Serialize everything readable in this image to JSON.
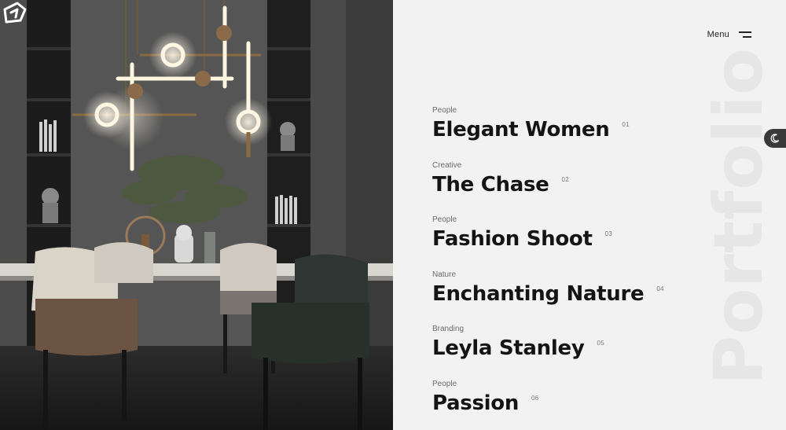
{
  "brand": {
    "logo": "logo-icon"
  },
  "header": {
    "menu_label": "Menu",
    "menu_icon": "hamburger-icon"
  },
  "watermark": "Portfolio",
  "theme_toggle": {
    "icon": "moon-icon"
  },
  "projects": [
    {
      "category": "People",
      "title": "Elegant Women",
      "number": "01"
    },
    {
      "category": "Creative",
      "title": "The Chase",
      "number": "02"
    },
    {
      "category": "People",
      "title": "Fashion Shoot",
      "number": "03"
    },
    {
      "category": "Nature",
      "title": "Enchanting Nature",
      "number": "04"
    },
    {
      "category": "Branding",
      "title": "Leyla Stanley",
      "number": "05"
    },
    {
      "category": "People",
      "title": "Passion",
      "number": "06"
    }
  ],
  "colors": {
    "background": "#f2f2f2",
    "text": "#141414",
    "watermark": "#e6e6e6",
    "toggle": "#3a3a3a"
  }
}
